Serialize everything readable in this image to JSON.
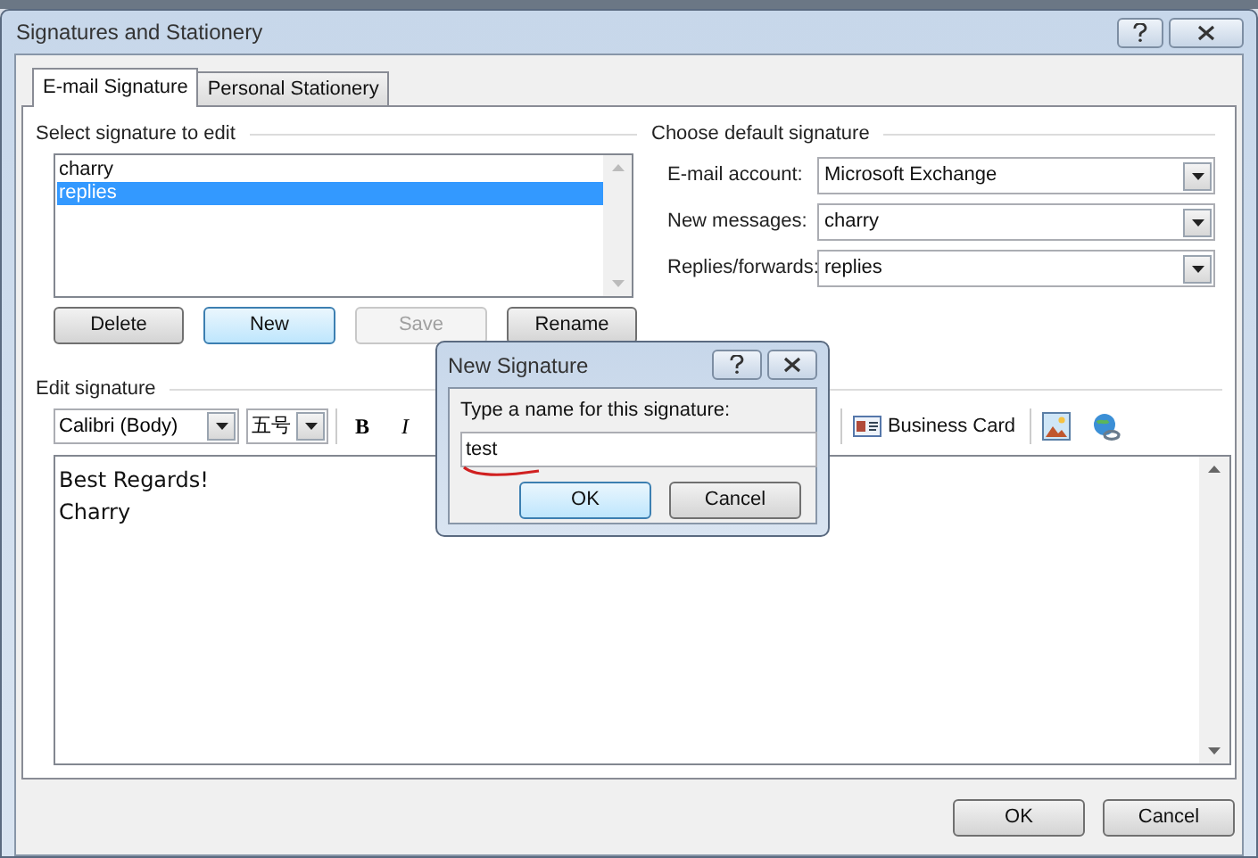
{
  "window": {
    "title": "Signatures and Stationery"
  },
  "tabs": [
    {
      "label": "E-mail Signature",
      "selected": true
    },
    {
      "label": "Personal Stationery",
      "selected": false
    }
  ],
  "select_signature": {
    "heading": "Select signature to edit",
    "items": [
      {
        "label": "charry",
        "selected": false
      },
      {
        "label": "replies",
        "selected": true
      }
    ],
    "buttons": [
      {
        "label": "Delete",
        "disabled": false,
        "focused": false
      },
      {
        "label": "New",
        "disabled": false,
        "focused": true
      },
      {
        "label": "Save",
        "disabled": true,
        "focused": false
      },
      {
        "label": "Rename",
        "disabled": false,
        "focused": false
      }
    ]
  },
  "default_signature": {
    "heading": "Choose default signature",
    "fields": [
      {
        "label": "E-mail account:",
        "value": "Microsoft Exchange"
      },
      {
        "label": "New messages:",
        "value": "charry"
      },
      {
        "label": "Replies/forwards:",
        "value": "replies"
      }
    ]
  },
  "edit_signature": {
    "heading": "Edit signature",
    "font": "Calibri (Body)",
    "size": "五号",
    "bold": "B",
    "italic": "I",
    "business_card": "Business Card",
    "lines": [
      "Best Regards!",
      "Charry"
    ]
  },
  "footer_buttons": [
    "OK",
    "Cancel"
  ],
  "new_signature_dialog": {
    "title": "New Signature",
    "prompt": "Type a name for this signature:",
    "value": "test",
    "buttons": [
      {
        "label": "OK",
        "focused": true
      },
      {
        "label": "Cancel",
        "focused": false
      }
    ]
  }
}
